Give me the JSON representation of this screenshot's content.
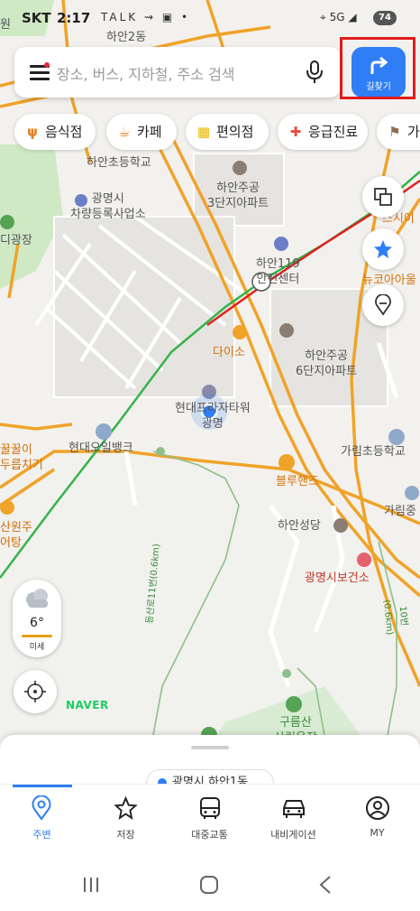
{
  "status_bar": {
    "carrier": "SKT",
    "time": "2:17",
    "left_icons": "TALK ⇝ ▣ •",
    "right_icons": "⌖ 5G ◢",
    "battery": "74"
  },
  "search": {
    "placeholder": "장소, 버스, 지하철, 주소 검색",
    "directions_label": "길찾기"
  },
  "chips": [
    {
      "icon": "ψ",
      "label": "음식점",
      "color": "#e67e22"
    },
    {
      "icon": "☕",
      "label": "카페",
      "color": "#e67e22"
    },
    {
      "icon": "▦",
      "label": "편의점",
      "color": "#f1c40f"
    },
    {
      "icon": "✚",
      "label": "응급진료",
      "color": "#e74c3c"
    },
    {
      "icon": "⚑",
      "label": "가",
      "color": "#8e6e53"
    }
  ],
  "map_labels": {
    "top_partial": "하안2동",
    "left_partial": "원",
    "school1": "하안초등학교",
    "apt3": "하안주공\n3단지아파트",
    "car_office": "광명시\n차량등록사업소",
    "sweetsee": "스시이",
    "plaza": "디광장",
    "fire": "하안119\n안전센터",
    "newyork": "뉴코아아울",
    "daiso": "다이소",
    "apt6": "하안주공\n6단지아파트",
    "hyundai_tower": "현대프라자타워\n광명",
    "kkul": "꿀꿀이\n두릅치기",
    "oilbank": "현대오일뱅크",
    "garim_school": "가림초등학교",
    "bluehands": "블루핸즈",
    "garimjung": "가림중",
    "sanwon": "산원주\n어탕",
    "church": "하안성당",
    "health": "광명시보건소",
    "trail1": "등산로11번(0.6km)",
    "trail2": "10번(0.6km)",
    "mountain": "구름산\n산림욕장"
  },
  "weather": {
    "temperature": "6°",
    "dust_label": "미세"
  },
  "brand": "NAVER",
  "bottom_sheet": {
    "peek_text": "광명시 하안1동"
  },
  "tabs": [
    {
      "label": "주변",
      "icon": "location-pin-icon",
      "active": true
    },
    {
      "label": "저장",
      "icon": "star-icon",
      "active": false
    },
    {
      "label": "대중교통",
      "icon": "bus-icon",
      "active": false
    },
    {
      "label": "내비게이션",
      "icon": "car-icon",
      "active": false
    },
    {
      "label": "MY",
      "icon": "profile-icon",
      "active": false
    }
  ],
  "colors": {
    "accent": "#2f7ef5",
    "road_major": "#f0a329",
    "subway_red": "#e02020",
    "subway_green": "#36b34a",
    "park": "#cfe9c5",
    "highlight_box": "#e01b1b"
  }
}
